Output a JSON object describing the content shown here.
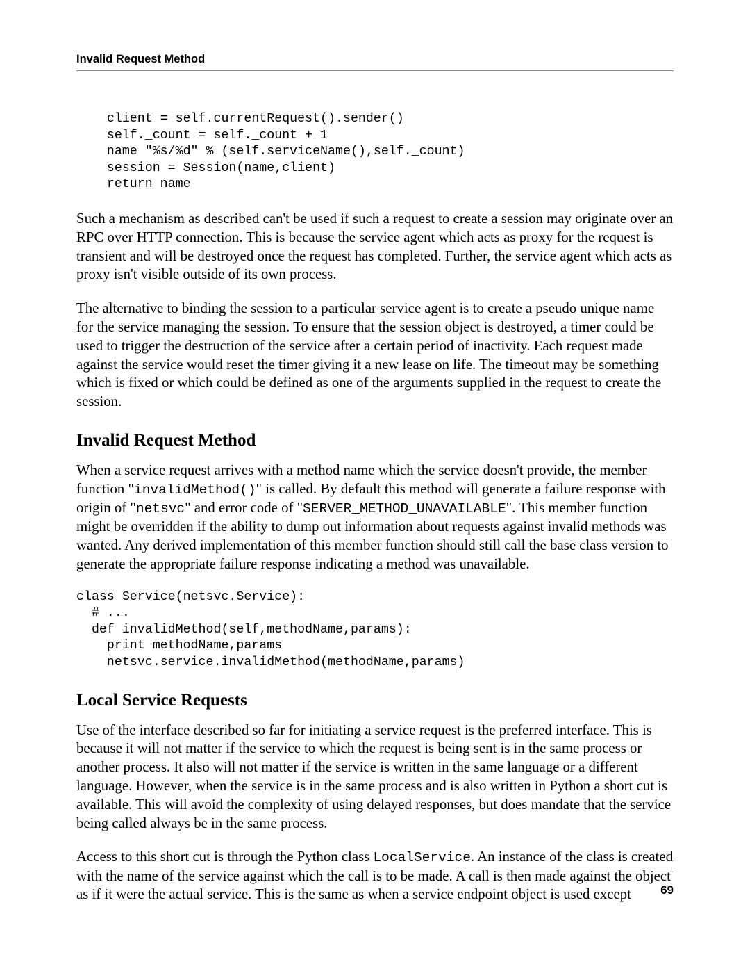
{
  "header": {
    "running_title": "Invalid Request Method"
  },
  "code": {
    "block1": "    client = self.currentRequest().sender()\n    self._count = self._count + 1\n    name \"%s/%d\" % (self.serviceName(),self._count)\n    session = Session(name,client)\n    return name",
    "block2": "class Service(netsvc.Service):\n  # ...\n  def invalidMethod(self,methodName,params):\n    print methodName,params\n    netsvc.service.invalidMethod(methodName,params)"
  },
  "paragraphs": {
    "p1": "Such a mechanism as described can't be used if such a request to create a session may originate over an RPC over HTTP connection. This is because the service agent which acts as proxy for the request is transient and will be destroyed once the request has completed. Further, the service agent which acts as proxy isn't visible outside of its own process.",
    "p2": "The alternative to binding the session to a particular service agent is to create a pseudo unique name for the service managing the session. To ensure that the session object is destroyed, a timer could be used to trigger the destruction of the service after a certain period of inactivity. Each request made against the service would reset the timer giving it a new lease on life. The timeout may be something which is fixed or which could be defined as one of the arguments supplied in the request to create the session.",
    "p3_a": "When a service request arrives with a method name which the service doesn't provide, the member function \"",
    "p3_code1": "invalidMethod()",
    "p3_b": "\" is called. By default this method will generate a failure response with origin of \"",
    "p3_code2": "netsvc",
    "p3_c": "\" and error code of \"",
    "p3_code3": "SERVER_METHOD_UNAVAILABLE",
    "p3_d": "\". This member function might be overridden if the ability to dump out information about requests against invalid methods was wanted. Any derived implementation of this member function should still call the base class version to generate the appropriate failure response indicating a method was unavailable.",
    "p4": "Use of the interface described so far for initiating a service request is the preferred interface. This is because it will not matter if the service to which the request is being sent is in the same process or another process. It also will not matter if the service is written in the same language or a different language. However, when the service is in the same process and is also written in Python a short cut is available. This will avoid the complexity of using delayed responses, but does mandate that the service being called always be in the same process.",
    "p5_a": "Access to this short cut is through the Python class ",
    "p5_code1": "LocalService",
    "p5_b": ". An instance of the class is created with the name of the service against which the call is to be made. A call is then made against the object as if it were the actual service. This is the same as when a service endpoint object is used except"
  },
  "headings": {
    "h1": "Invalid Request Method",
    "h2": "Local Service Requests"
  },
  "footer": {
    "page_number": "69"
  }
}
